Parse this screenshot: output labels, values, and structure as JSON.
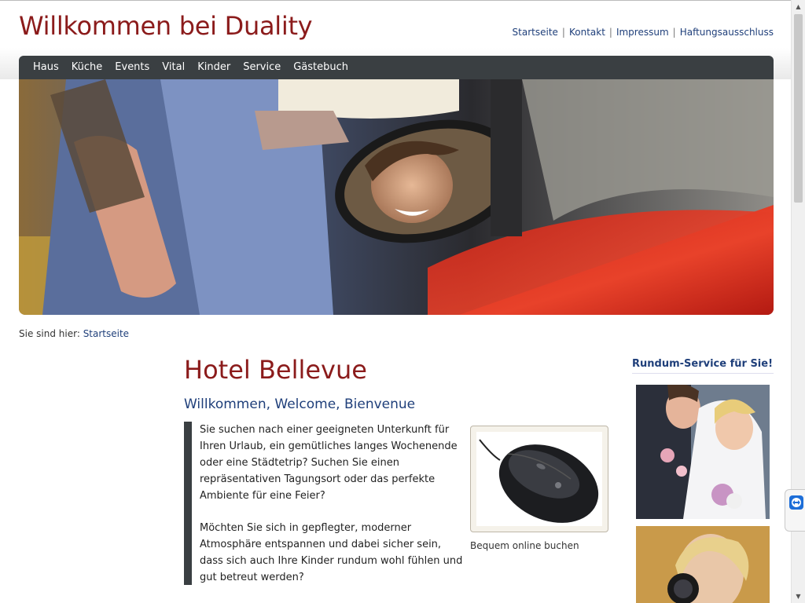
{
  "header": {
    "site_title": "Willkommen bei Duality",
    "meta_links": [
      "Startseite",
      "Kontakt",
      "Impressum",
      "Haftungsausschluss"
    ]
  },
  "nav": {
    "items": [
      "Haus",
      "Küche",
      "Events",
      "Vital",
      "Kinder",
      "Service",
      "Gästebuch"
    ]
  },
  "breadcrumb": {
    "prefix": "Sie sind hier:",
    "link": "Startseite"
  },
  "content": {
    "title": "Hotel Bellevue",
    "subtitle": "Willkommen, Welcome, Bienvenue",
    "paragraphs": [
      "Sie suchen nach einer geeigneten Unterkunft für Ihren Urlaub, ein gemütliches langes Wochenende oder eine Städtetrip? Suchen Sie einen repräsentativen Tagungsort oder das perfekte Ambiente für eine Feier?",
      "Möchten Sie sich in gepflegter, moderner Atmosphäre entspannen und dabei sicher sein, dass sich auch Ihre Kinder rundum wohl fühlen und gut betreut werden?"
    ],
    "image_caption": "Bequem online buchen"
  },
  "sidebar": {
    "heading": "Rundum-Service für Sie!"
  },
  "icons": {
    "widget": "teamviewer-icon"
  },
  "colors": {
    "brand_red": "#8b1b1b",
    "link_blue": "#1f3f7a",
    "nav_bg": "#3a3f42"
  }
}
